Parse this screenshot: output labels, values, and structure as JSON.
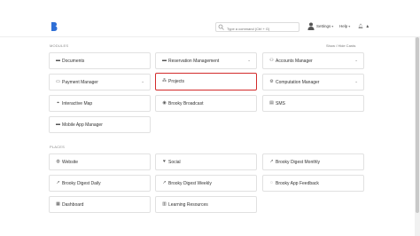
{
  "header": {
    "search_placeholder": "Type a command (Ctrl + G)",
    "settings_label": "Settings",
    "help_label": "Help"
  },
  "sections": {
    "modules_label": "MODULES",
    "show_hide_label": "Show / Hide Cards",
    "places_label": "PLACES"
  },
  "modules": [
    {
      "label": "Documents",
      "icon": "folder-icon",
      "caret": false
    },
    {
      "label": "Reservation Management",
      "icon": "folder-icon",
      "caret": true
    },
    {
      "label": "Accounts Manager",
      "icon": "users-icon",
      "caret": true
    },
    {
      "label": "Payment Manager",
      "icon": "card-icon",
      "caret": true
    },
    {
      "label": "Projects",
      "icon": "projects-icon",
      "caret": false,
      "selected": true
    },
    {
      "label": "Computation Manager",
      "icon": "cogs-icon",
      "caret": true
    },
    {
      "label": "Interactive Map",
      "icon": "map-icon",
      "caret": false
    },
    {
      "label": "Brooky Broadcast",
      "icon": "broadcast-icon",
      "caret": false
    },
    {
      "label": "SMS",
      "icon": "sms-icon",
      "caret": false
    },
    {
      "label": "Mobile App Manager",
      "icon": "folder-icon",
      "caret": false
    }
  ],
  "places": [
    {
      "label": "Website",
      "icon": "globe-icon"
    },
    {
      "label": "Social",
      "icon": "heart-icon"
    },
    {
      "label": "Brooky Digest Monthly",
      "icon": "chart-icon"
    },
    {
      "label": "Brooky Digest Daily",
      "icon": "chart-icon"
    },
    {
      "label": "Brooky Digest Weekly",
      "icon": "chart-icon"
    },
    {
      "label": "Brooky App Feedback",
      "icon": "comment-icon"
    },
    {
      "label": "Dashboard",
      "icon": "dashboard-icon"
    },
    {
      "label": "Learning Resources",
      "icon": "book-icon"
    }
  ],
  "colors": {
    "brand": "#2f6fd6",
    "selected_border": "#d22b2b"
  }
}
